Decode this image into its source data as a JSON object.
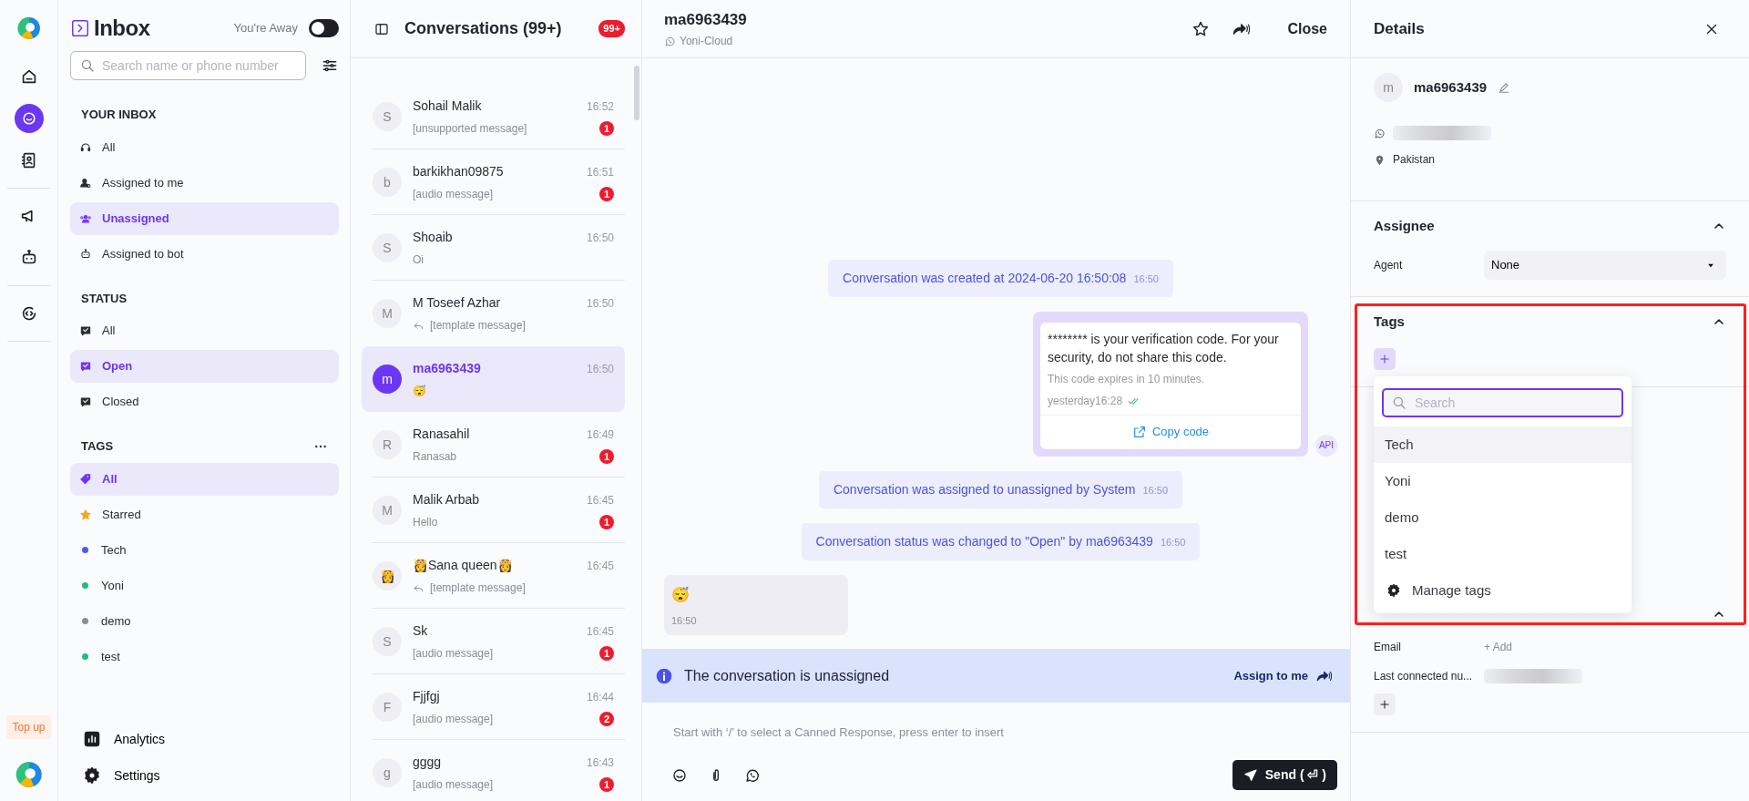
{
  "rail": {
    "groups": [
      [
        {
          "selected": false
        },
        {
          "selected": true
        },
        {
          "selected": false
        }
      ],
      [
        {
          "selected": false
        },
        {
          "selected": false
        }
      ],
      [
        {
          "selected": false
        }
      ]
    ],
    "topup": "Top up"
  },
  "sidebar": {
    "title": "Inbox",
    "away_label": "You're Away",
    "away_on": false,
    "search": {
      "placeholder": "Search name or phone number"
    },
    "sections": [
      {
        "title": "YOUR INBOX",
        "items": [
          {
            "label": "All",
            "kind": "icon",
            "selected": false
          },
          {
            "label": "Assigned to me",
            "kind": "icon",
            "selected": false
          },
          {
            "label": "Unassigned",
            "kind": "icon",
            "selected": true
          },
          {
            "label": "Assigned to bot",
            "kind": "icon",
            "selected": false
          }
        ]
      },
      {
        "title": "STATUS",
        "items": [
          {
            "label": "All",
            "kind": "icon",
            "selected": false
          },
          {
            "label": "Open",
            "kind": "icon",
            "selected": true
          },
          {
            "label": "Closed",
            "kind": "icon",
            "selected": false
          }
        ]
      },
      {
        "title": "TAGS",
        "more": true,
        "items": [
          {
            "label": "All",
            "kind": "icon",
            "selected": true
          },
          {
            "label": "Starred",
            "kind": "icon",
            "selected": false
          },
          {
            "label": "Tech",
            "kind": "dot",
            "color": "#4a5cf5",
            "selected": false
          },
          {
            "label": "Yoni",
            "kind": "dot",
            "color": "#1fbf7a",
            "selected": false
          },
          {
            "label": "demo",
            "kind": "dot",
            "color": "#8d8a9b",
            "selected": false
          },
          {
            "label": "test",
            "kind": "dot",
            "color": "#1fbf7a",
            "selected": false
          }
        ]
      }
    ],
    "footer": [
      {
        "label": "Analytics"
      },
      {
        "label": "Settings"
      }
    ]
  },
  "conversations": {
    "title": "Conversations (99+)",
    "badge": "99+",
    "items": [
      {
        "avatar": "S",
        "name": "Sohail Malik",
        "time": "16:52",
        "preview": "[unsupported message]",
        "template": false,
        "unread": "1",
        "selected": false
      },
      {
        "avatar": "b",
        "name": "barkikhan09875",
        "time": "16:51",
        "preview": "[audio message]",
        "template": false,
        "unread": "1",
        "selected": false
      },
      {
        "avatar": "S",
        "name": "Shoaib",
        "time": "16:50",
        "preview": "Oi",
        "template": false,
        "selected": false
      },
      {
        "avatar": "M",
        "name": "M Toseef Azhar",
        "time": "16:50",
        "preview": "[template message]",
        "template": true,
        "selected": false
      },
      {
        "avatar": "m",
        "name": "ma6963439",
        "time": "16:50",
        "preview": "😴",
        "template": false,
        "selected": true
      },
      {
        "avatar": "R",
        "name": "Ranasahil",
        "time": "16:49",
        "preview": "Ranasab",
        "template": false,
        "unread": "1",
        "selected": false
      },
      {
        "avatar": "M",
        "name": "Malik Arbab",
        "time": "16:45",
        "preview": "Hello",
        "template": false,
        "unread": "1",
        "selected": false
      },
      {
        "avatar": "👸",
        "name": "👸Sana queen👸",
        "time": "16:45",
        "preview": "[template message]",
        "template": true,
        "selected": false
      },
      {
        "avatar": "S",
        "name": "Sk",
        "time": "16:45",
        "preview": "[audio message]",
        "template": false,
        "unread": "1",
        "selected": false
      },
      {
        "avatar": "F",
        "name": "Fjjfgj",
        "time": "16:44",
        "preview": "[audio message]",
        "template": false,
        "unread": "2",
        "selected": false
      },
      {
        "avatar": "g",
        "name": "gggg",
        "time": "16:43",
        "preview": "[audio message]",
        "template": false,
        "unread": "1",
        "selected": false
      }
    ]
  },
  "chat": {
    "title": "ma6963439",
    "channel": "Yoni-Cloud",
    "close": "Close",
    "messages": [
      {
        "kind": "activity",
        "text": "Conversation was created at 2024-06-20 16:50:08",
        "time": "16:50"
      },
      {
        "kind": "template",
        "text": "******** is your verification code. For your security, do not share this code.",
        "footer": "This code expires in 10 minutes.",
        "time": "yesterday16:28",
        "read": true,
        "button": "Copy code",
        "sender": "API"
      },
      {
        "kind": "activity",
        "text": "Conversation was assigned to unassigned by System",
        "time": "16:50"
      },
      {
        "kind": "activity",
        "text": "Conversation status was changed to \"Open\" by ma6963439",
        "time": "16:50"
      },
      {
        "kind": "incoming",
        "text": "😴",
        "time": "16:50"
      }
    ],
    "banner": {
      "text": "The conversation is unassigned",
      "action": "Assign to me"
    },
    "composer": {
      "placeholder": "Start with ‘/’ to select a Canned Response, press enter to insert",
      "send": "Send ( ⏎ )"
    }
  },
  "details": {
    "title": "Details",
    "contact": {
      "avatar": "m",
      "name": "ma6963439",
      "location": "Pakistan"
    },
    "sections": [
      {
        "title": "Assignee",
        "expanded": true,
        "fields": [
          {
            "label": "Agent",
            "value": "None",
            "kind": "select"
          }
        ]
      },
      {
        "title": "Tags",
        "expanded": true,
        "highlighted": true
      },
      {
        "expanded": true,
        "fields": [
          {
            "label": "Email",
            "value": "+ Add",
            "kind": "link"
          },
          {
            "label": "Last connected nu...",
            "kind": "redacted"
          }
        ]
      }
    ],
    "tag_menu": {
      "placeholder": "Search",
      "items": [
        {
          "label": "Tech",
          "selected": true
        },
        {
          "label": "Yoni",
          "selected": false
        },
        {
          "label": "demo",
          "selected": false
        },
        {
          "label": "test",
          "selected": false
        }
      ],
      "manage": "Manage tags"
    }
  }
}
